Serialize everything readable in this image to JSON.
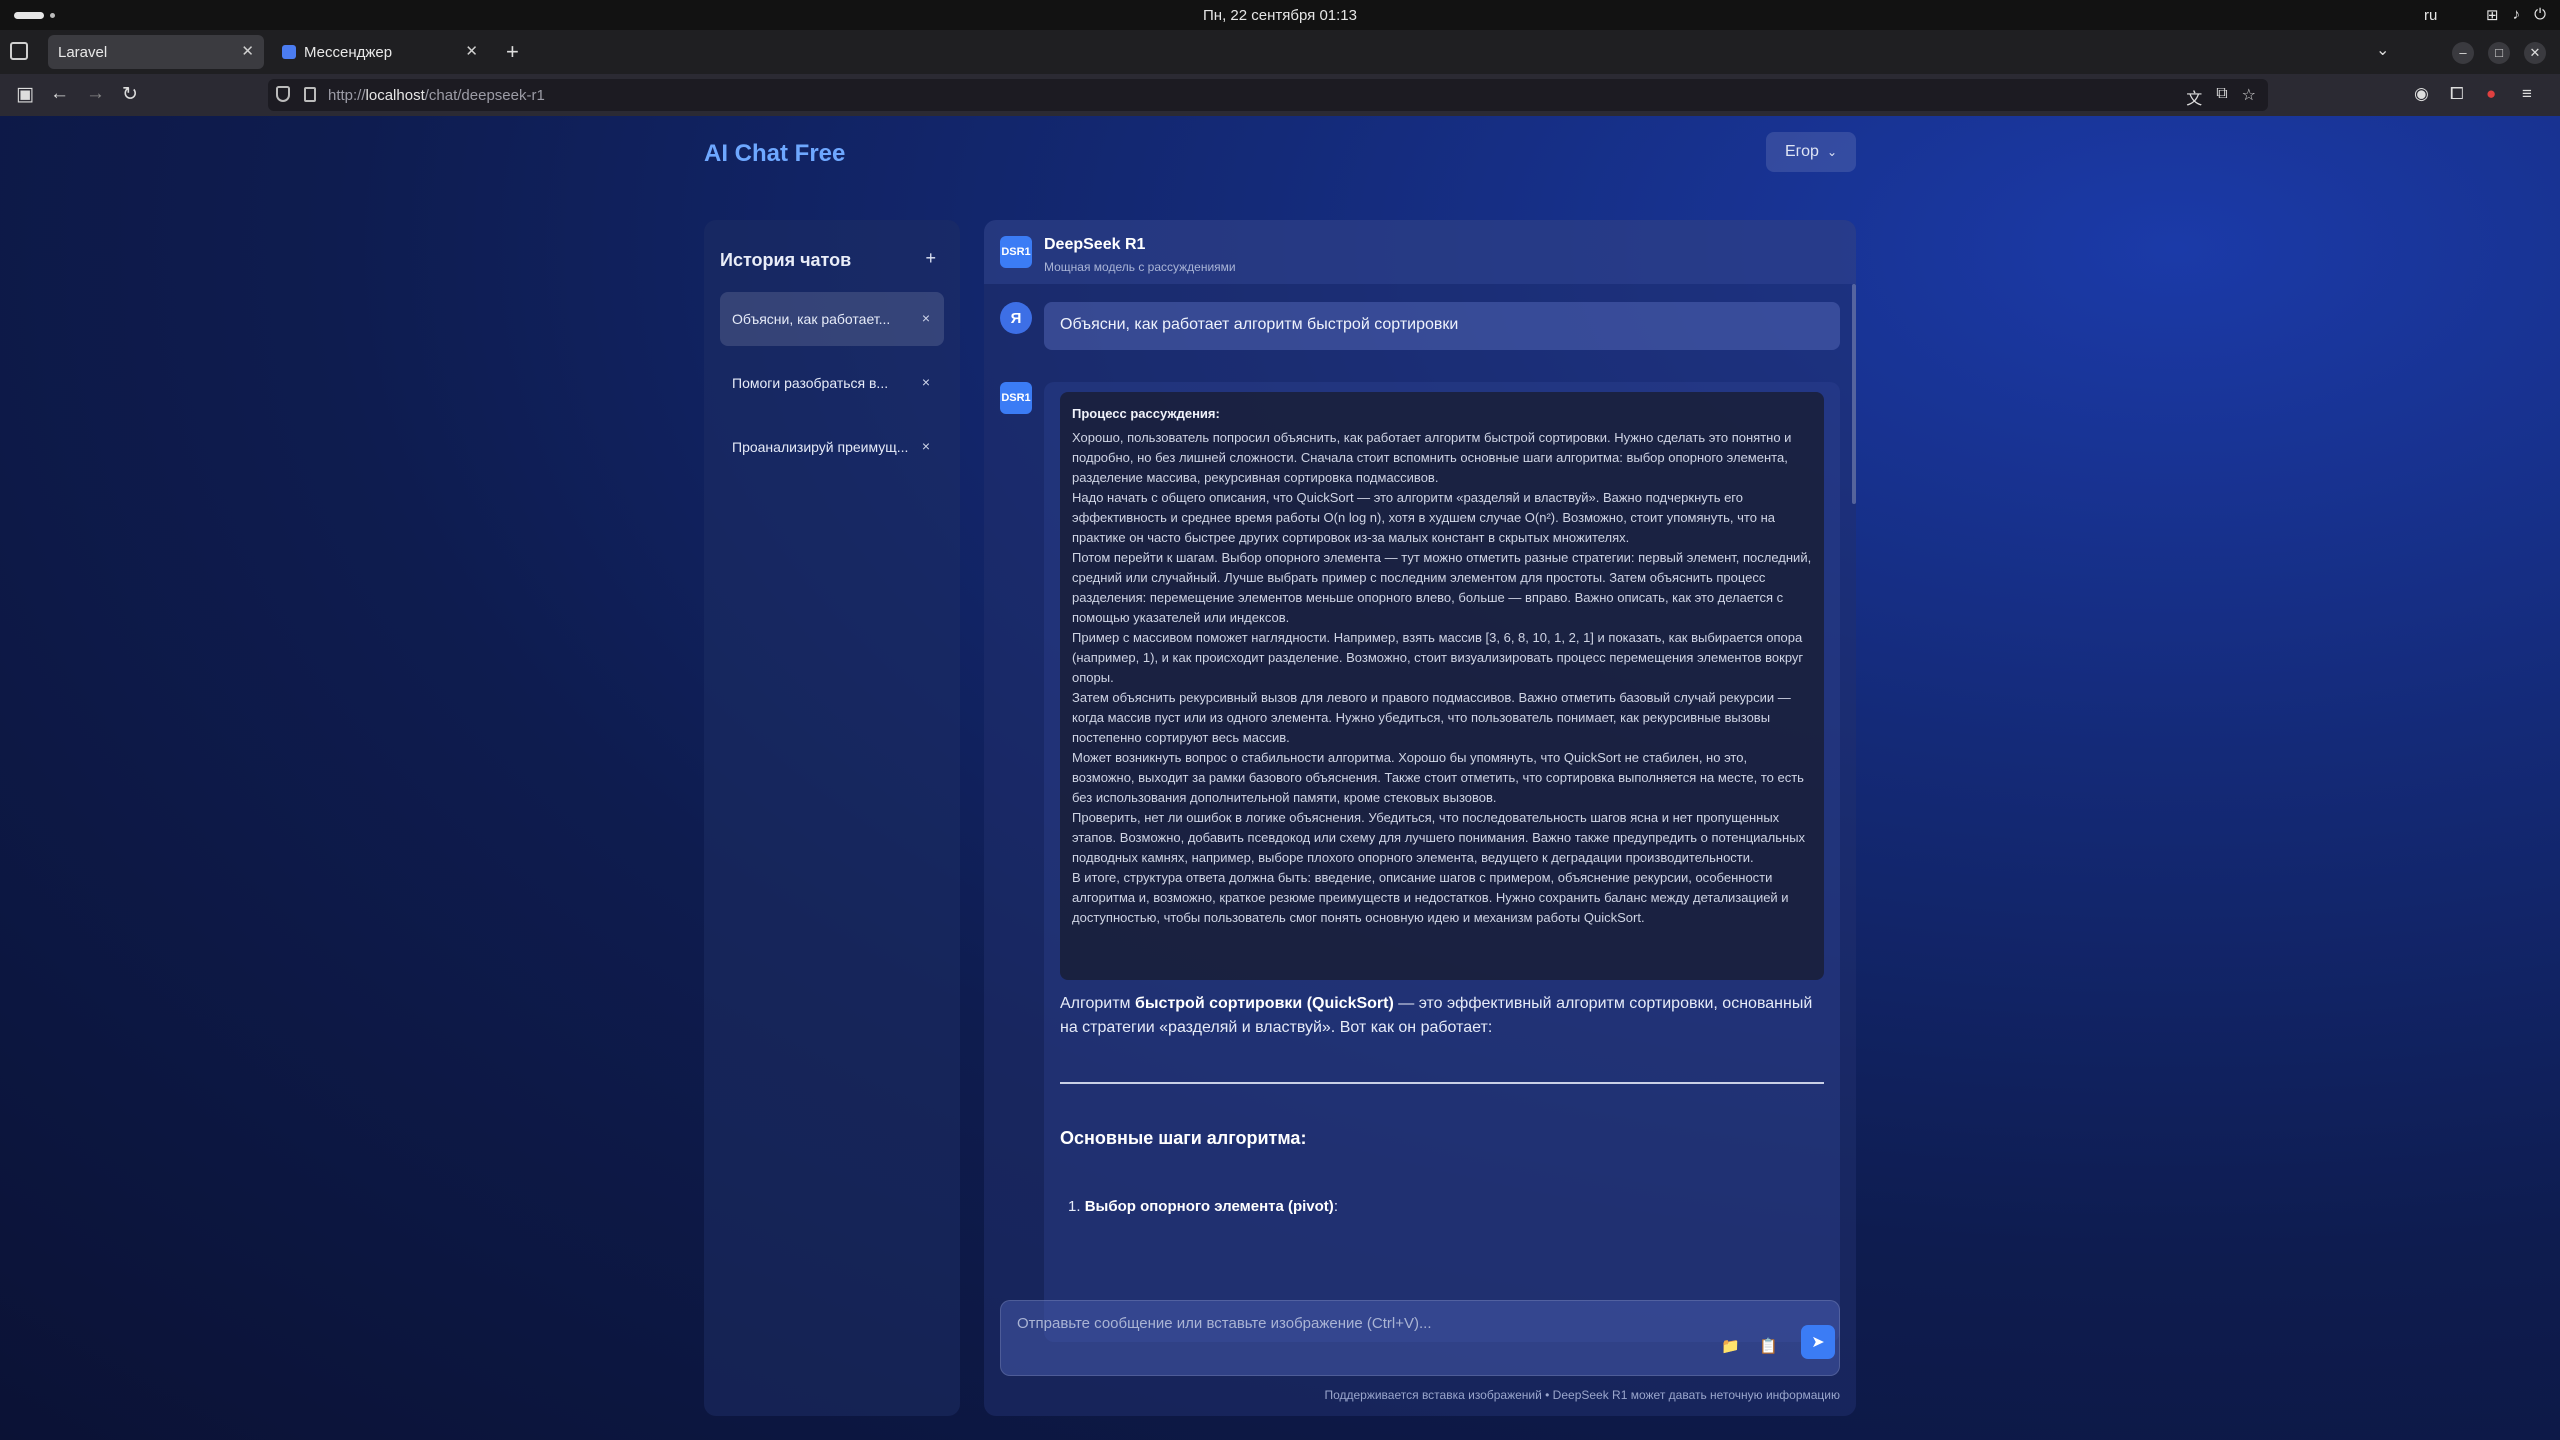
{
  "os": {
    "clock": "Пн, 22 сентября  01:13",
    "lang": "ru"
  },
  "browser": {
    "tabs": [
      {
        "label": "Laravel"
      },
      {
        "label": "Мессенджер"
      }
    ],
    "url_prefix": "http://",
    "url_host": "localhost",
    "url_path": "/chat/deepseek-r1"
  },
  "app": {
    "brand": "AI Chat Free",
    "user_label": "Егор",
    "sidebar": {
      "title": "История чатов",
      "add_label": "+",
      "items": [
        {
          "label": "Объясни, как работает..."
        },
        {
          "label": "Помоги разобраться в..."
        },
        {
          "label": "Проанализируй преимущ..."
        }
      ]
    },
    "chat": {
      "model_avatar": "DSR1",
      "model_name": "DeepSeek R1",
      "model_desc": "Мощная модель с рассуждениями",
      "user_avatar": "Я",
      "user_message": "Объясни, как работает алгоритм быстрой сортировки",
      "reasoning_title": "Процесс рассуждения:",
      "reasoning_lines": [
        "Хорошо, пользователь попросил объяснить, как работает алгоритм быстрой сортировки. Нужно сделать это понятно и подробно, но без лишней сложности. Сначала стоит вспомнить основные шаги алгоритма: выбор опорного элемента, разделение массива, рекурсивная сортировка подмассивов.",
        "Надо начать с общего описания, что QuickSort — это алгоритм «разделяй и властвуй». Важно подчеркнуть его эффективность и среднее время работы O(n log n), хотя в худшем случае O(n²). Возможно, стоит упомянуть, что на практике он часто быстрее других сортировок из-за малых констант в скрытых множителях.",
        "Потом перейти к шагам. Выбор опорного элемента — тут можно отметить разные стратегии: первый элемент, последний, средний или случайный. Лучше выбрать пример с последним элементом для простоты. Затем объяснить процесс разделения: перемещение элементов меньше опорного влево, больше — вправо. Важно описать, как это делается с помощью указателей или индексов.",
        "Пример с массивом поможет наглядности. Например, взять массив [3, 6, 8, 10, 1, 2, 1] и показать, как выбирается опора (например, 1), и как происходит разделение. Возможно, стоит визуализировать процесс перемещения элементов вокруг опоры.",
        "Затем объяснить рекурсивный вызов для левого и правого подмассивов. Важно отметить базовый случай рекурсии — когда массив пуст или из одного элемента. Нужно убедиться, что пользователь понимает, как рекурсивные вызовы постепенно сортируют весь массив.",
        "Может возникнуть вопрос о стабильности алгоритма. Хорошо бы упомянуть, что QuickSort не стабилен, но это, возможно, выходит за рамки базового объяснения. Также стоит отметить, что сортировка выполняется на месте, то есть без использования дополнительной памяти, кроме стековых вызовов.",
        "Проверить, нет ли ошибок в логике объяснения. Убедиться, что последовательность шагов ясна и нет пропущенных этапов. Возможно, добавить псевдокод или схему для лучшего понимания. Важно также предупредить о потенциальных подводных камнях, например, выборе плохого опорного элемента, ведущего к деградации производительности.",
        "В итоге, структура ответа должна быть: введение, описание шагов с примером, объяснение рекурсии, особенности алгоритма и, возможно, краткое резюме преимуществ и недостатков. Нужно сохранить баланс между детализацией и доступностью, чтобы пользователь смог понять основную идею и механизм работы QuickSort."
      ],
      "answer_pre": "Алгоритм ",
      "answer_bold": "быстрой сортировки (QuickSort)",
      "answer_post": " — это эффективный алгоритм сортировки, основанный на стратегии «разделяй и властвуй». Вот как он работает:",
      "section_title": "Основные шаги алгоритма:",
      "step1_num": "1.",
      "step1_bold": "Выбор опорного элемента (pivot)",
      "step1_post": ":",
      "input_placeholder": "Отправьте сообщение или вставьте изображение (Ctrl+V)...",
      "footer_note": "Поддерживается вставка изображений • DeepSeek R1 может давать неточную информацию"
    }
  }
}
